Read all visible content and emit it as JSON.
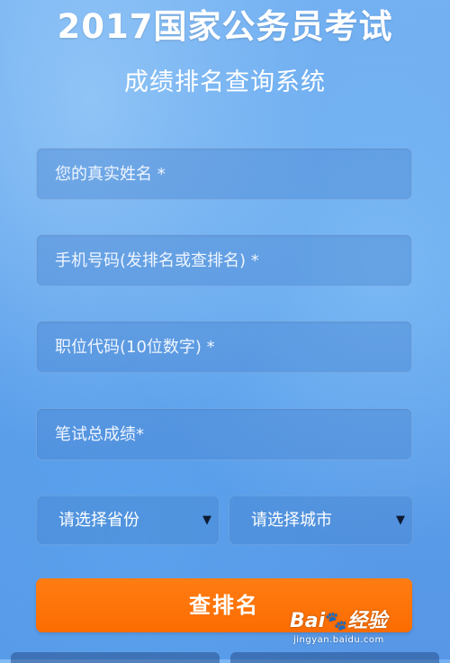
{
  "header": {
    "title": "2017国家公务员考试",
    "subtitle": "成绩排名查询系统"
  },
  "form": {
    "name_placeholder": "您的真实姓名 *",
    "phone_placeholder": "手机号码(发排名或查排名) *",
    "position_code_placeholder": "职位代码(10位数字) *",
    "score_placeholder": "笔试总成绩*",
    "province_select": "请选择省份",
    "city_select": "请选择城市",
    "submit_label": "查排名"
  },
  "watermark": {
    "logo_text_left": "Bai",
    "logo_text_right": "经验",
    "url": "jingyan.baidu.com"
  },
  "colors": {
    "submit": "#fb6c00",
    "background": "#5c9eea"
  },
  "icons": {
    "dropdown_arrow": "dropdown-arrow-icon",
    "baidu_paw": "baidu-paw-icon"
  }
}
